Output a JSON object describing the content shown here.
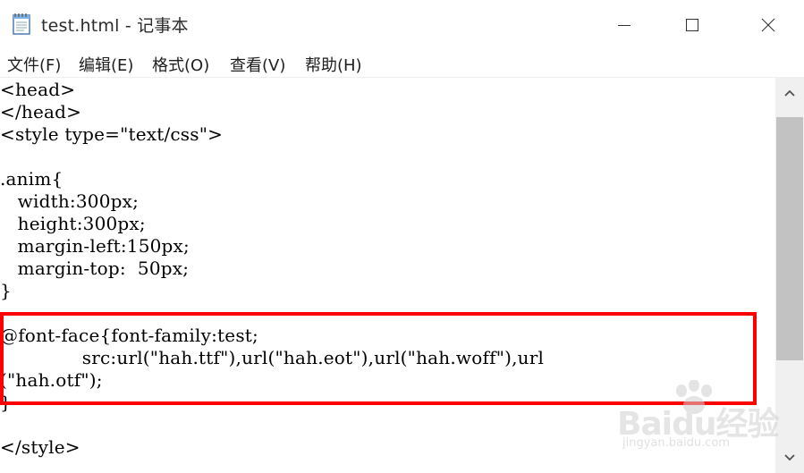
{
  "window": {
    "title": "test.html - 记事本",
    "icon": "notepad-icon"
  },
  "menu": {
    "items": [
      {
        "label": "文件(F)"
      },
      {
        "label": "编辑(E)"
      },
      {
        "label": "格式(O)"
      },
      {
        "label": "查看(V)"
      },
      {
        "label": "帮助(H)"
      }
    ]
  },
  "editor": {
    "lines": [
      "<head>",
      "</head>",
      "<style type=\"text/css\">",
      "",
      ".anim{",
      "   width:300px;",
      "   height:300px;",
      "   margin-left:150px;",
      "   margin-top:  50px;",
      "}",
      "",
      "@font-face{font-family:test;",
      "              src:url(\"hah.ttf\"),url(\"hah.eot\"),url(\"hah.woff\"),url",
      "(\"hah.otf\");",
      "}",
      "",
      "</style>"
    ]
  },
  "annotation": {
    "highlight_color": "#ff0000"
  },
  "watermark": {
    "logo": "Baidu经验",
    "url": "jingyan.baidu.com"
  }
}
